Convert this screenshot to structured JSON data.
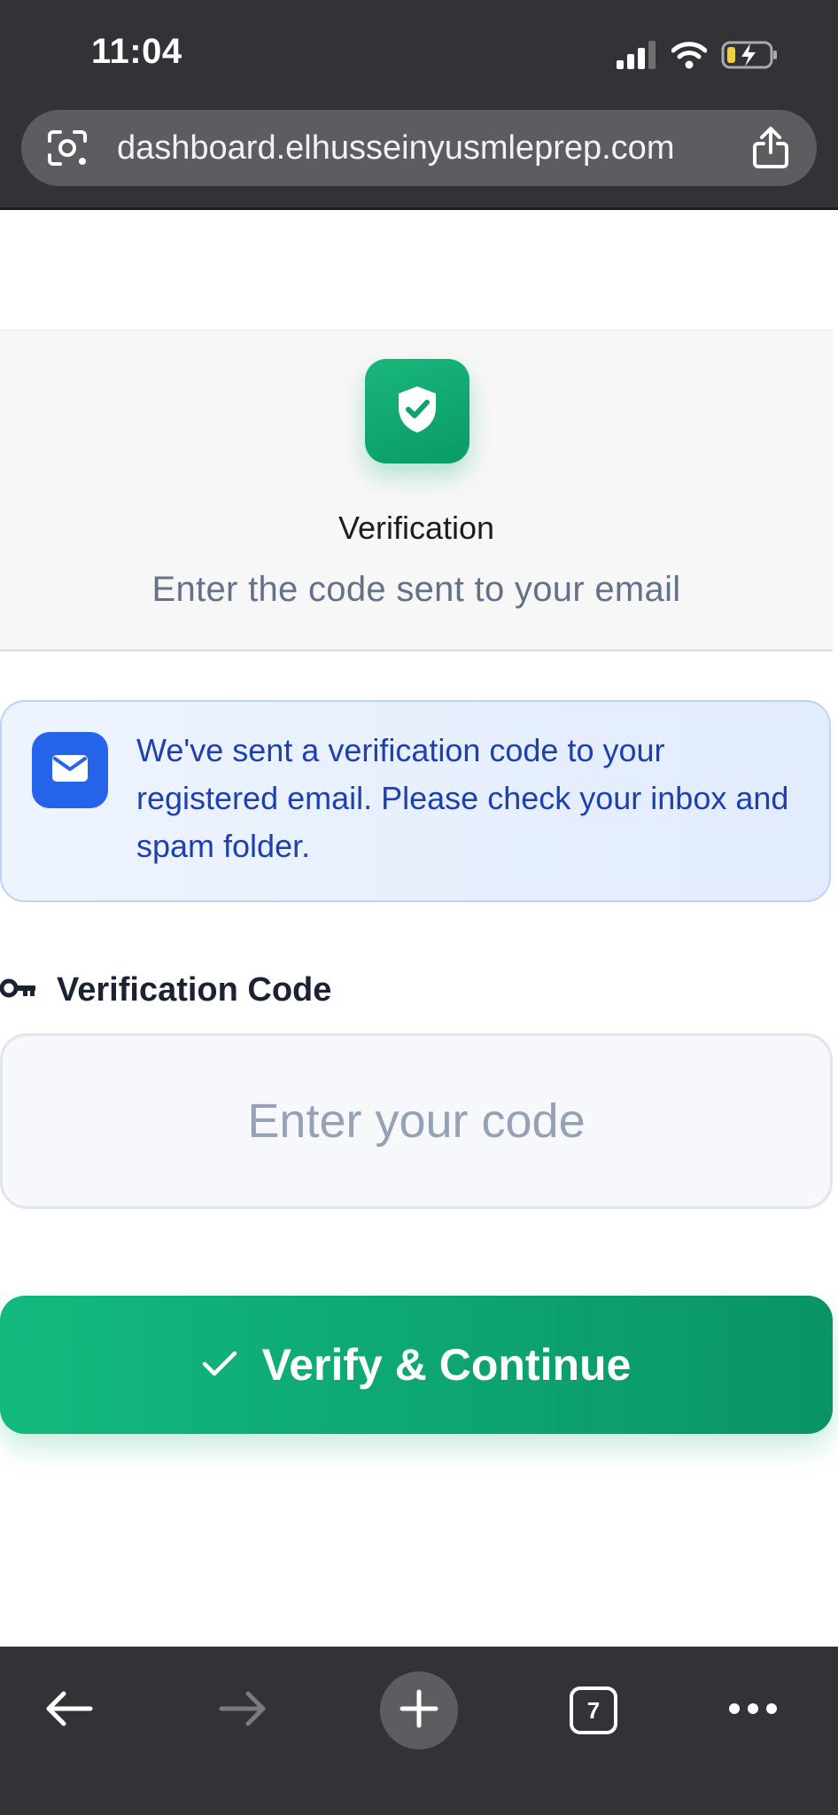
{
  "status_bar": {
    "time": "11:04",
    "icons": [
      "signal-icon",
      "wifi-icon",
      "battery-charging-icon"
    ]
  },
  "browser": {
    "url": "dashboard.elhusseinyusmleprep.com",
    "tab_count": "7",
    "toolbar_icons": [
      "back-arrow-icon",
      "forward-arrow-icon",
      "new-tab-plus-icon",
      "tabs-icon",
      "more-icon"
    ]
  },
  "header": {
    "icon": "shield-check-icon",
    "title": "Verification",
    "subtitle": "Enter the code sent to your email"
  },
  "info_banner": {
    "icon": "mail-icon",
    "message": "We've sent a verification code to your registered email. Please check your inbox and spam folder."
  },
  "code_field": {
    "icon": "key-icon",
    "label": "Verification Code",
    "value": "",
    "placeholder": "Enter your code"
  },
  "verify_button": {
    "icon": "checkmark-icon",
    "label": "Verify & Continue"
  },
  "colors": {
    "accent_green": "#10b57b",
    "info_blue": "#2563eb",
    "info_text": "#1e40af",
    "chrome_dark": "#323336"
  }
}
